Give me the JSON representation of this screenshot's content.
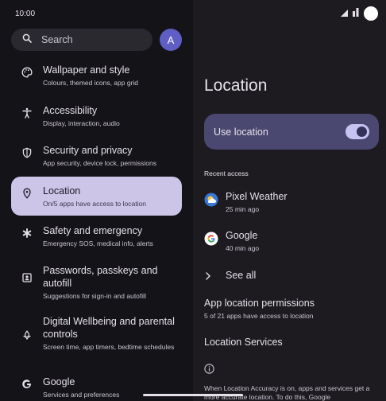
{
  "status_bar": {
    "time": "10:00"
  },
  "search": {
    "placeholder": "Search"
  },
  "account": {
    "avatar_letter": "A"
  },
  "menu": [
    {
      "title": "Wallpaper and style",
      "sub": "Colours, themed icons, app grid",
      "icon": "palette-icon"
    },
    {
      "title": "Accessibility",
      "sub": "Display, interaction, audio",
      "icon": "accessibility-icon"
    },
    {
      "title": "Security and privacy",
      "sub": "App security, device lock, permissions",
      "icon": "shield-icon"
    },
    {
      "title": "Location",
      "sub": "On/5 apps have access to location",
      "icon": "location-pin-icon"
    },
    {
      "title": "Safety and emergency",
      "sub": "Emergency SOS, medical info, alerts",
      "icon": "asterisk-icon"
    },
    {
      "title": "Passwords, passkeys and autofill",
      "sub": "Suggestions for sign-in and autofill",
      "icon": "person-card-icon"
    },
    {
      "title": "Digital Wellbeing and parental controls",
      "sub": "Screen time, app timers, bedtime schedules",
      "icon": "wellbeing-icon"
    },
    {
      "title": "Google",
      "sub": "Services and preferences",
      "icon": "google-g-icon"
    }
  ],
  "location_page": {
    "title": "Location",
    "use_location_label": "Use location",
    "use_location_on": true,
    "recent_access_label": "Recent access",
    "recent_apps": [
      {
        "title": "Pixel Weather",
        "sub": "25 min ago",
        "icon": "weather-icon"
      },
      {
        "title": "Google",
        "sub": "40 min ago",
        "icon": "google-logo-icon"
      }
    ],
    "see_all_label": "See all",
    "app_permissions_title": "App location permissions",
    "app_permissions_sub": "5 of 21 apps have access to location",
    "location_services_title": "Location Services",
    "footer_text": "When Location Accuracy is on, apps and services get a more accurate location. To do this, Google"
  },
  "colors": {
    "selected_item_bg": "#cdc5e8",
    "use_location_bg": "#4a4870",
    "avatar_bg": "#5e5ec4"
  }
}
